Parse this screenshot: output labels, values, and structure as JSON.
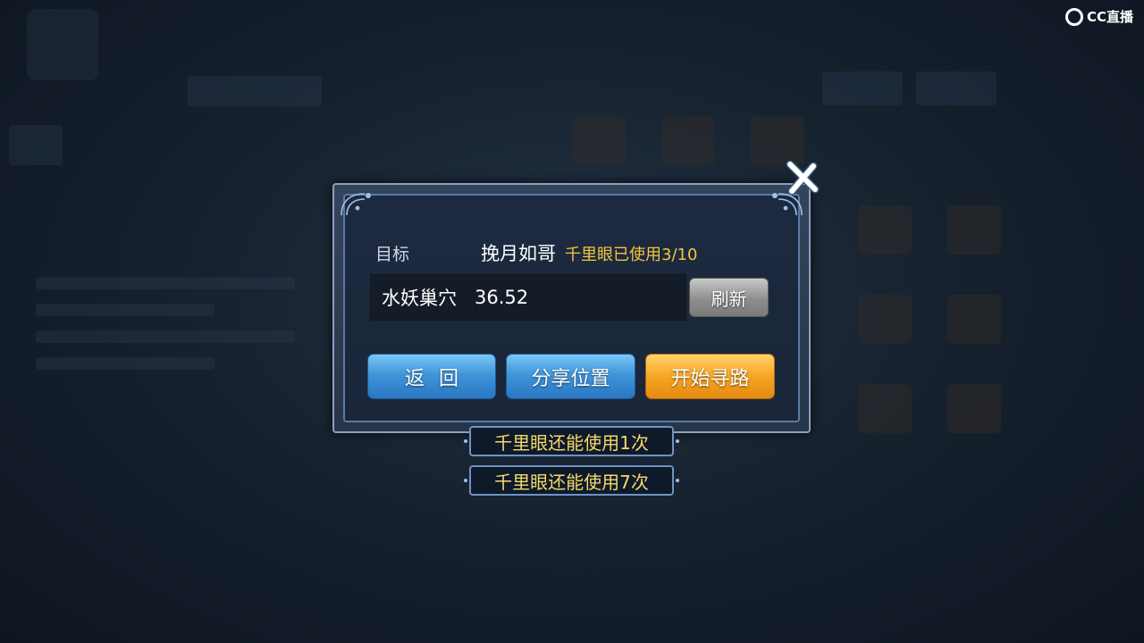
{
  "watermark": {
    "text": "CC直播"
  },
  "dialog": {
    "target_label": "目标",
    "target_name": "挽月如哥",
    "usage_text": "千里眼已使用3/10",
    "location_name": "水妖巢穴",
    "location_coords": "36.52",
    "refresh_label": "刷新",
    "back_label": "返回",
    "share_label": "分享位置",
    "start_label": "开始寻路",
    "close_icon": "close-x-icon"
  },
  "toasts": [
    "千里眼还能使用1次",
    "千里眼还能使用7次"
  ],
  "colors": {
    "usage_yellow": "#f2c53c",
    "toast_text": "#f5d86a",
    "button_blue": "#3f96da",
    "button_orange": "#f7a524",
    "refresh_gray": "#8e8e8e"
  }
}
